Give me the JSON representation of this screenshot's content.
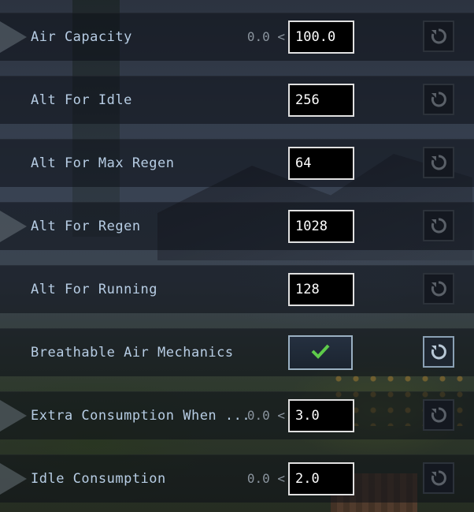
{
  "entries": [
    {
      "label": "Air Capacity",
      "min_hint": "0.0 <",
      "value": "100.0",
      "kind": "number",
      "reset_active": false
    },
    {
      "label": "Alt For Idle",
      "min_hint": "",
      "value": "256",
      "kind": "number",
      "reset_active": false
    },
    {
      "label": "Alt For Max Regen",
      "min_hint": "",
      "value": "64",
      "kind": "number",
      "reset_active": false
    },
    {
      "label": "Alt For Regen",
      "min_hint": "",
      "value": "1028",
      "kind": "number",
      "reset_active": false
    },
    {
      "label": "Alt For Running",
      "min_hint": "",
      "value": "128",
      "kind": "number",
      "reset_active": false
    },
    {
      "label": "Breathable Air Mechanics",
      "min_hint": "",
      "value": "",
      "kind": "toggle",
      "checked": true,
      "reset_active": true
    },
    {
      "label": "Extra Consumption When ...",
      "min_hint": "0.0 <",
      "value": "3.0",
      "kind": "number",
      "reset_active": false
    },
    {
      "label": "Idle Consumption",
      "min_hint": "0.0 <",
      "value": "2.0",
      "kind": "number",
      "reset_active": false
    }
  ],
  "icons": {
    "reset": "reset-icon",
    "check": "checkmark-icon",
    "expand": "expand-arrow-icon"
  },
  "colors": {
    "label": "#b7cde4",
    "check": "#5ecb4a",
    "reset_inactive": "#5a6068",
    "reset_active": "#b8c8d6"
  }
}
